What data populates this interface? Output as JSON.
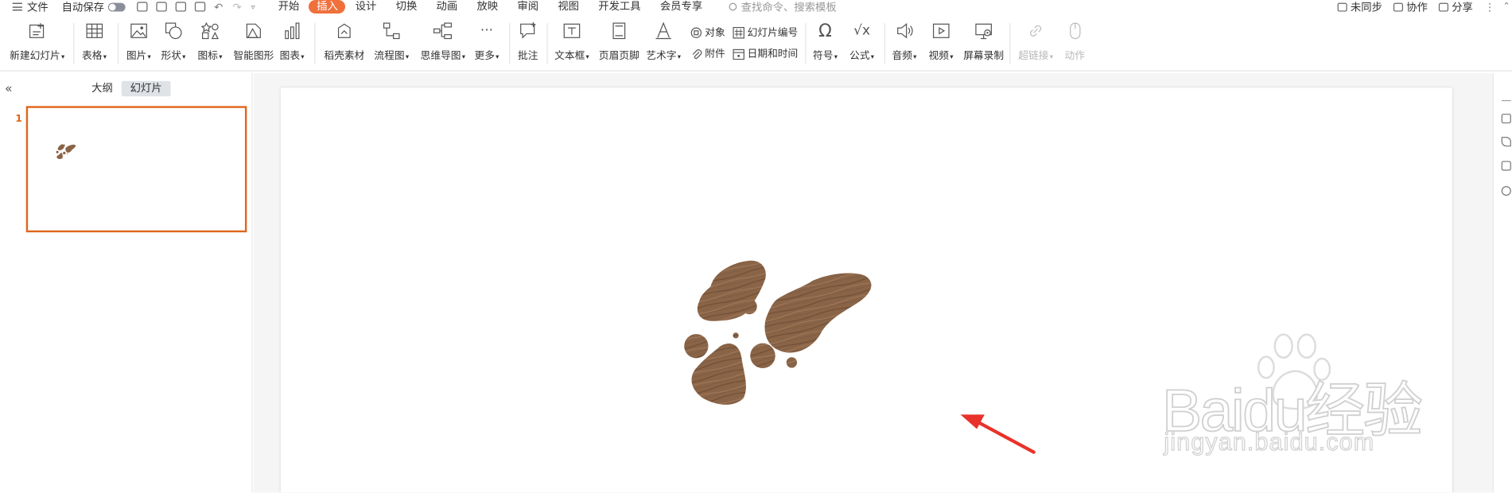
{
  "menubar": {
    "file": "文件",
    "autosave": "自动保存",
    "tabs": [
      "开始",
      "插入",
      "设计",
      "切换",
      "动画",
      "放映",
      "审阅",
      "视图",
      "开发工具",
      "会员专享"
    ],
    "active_tab": "插入",
    "search_placeholder": "查找命令、搜索模板",
    "sync": "未同步",
    "collab": "协作",
    "share": "分享"
  },
  "ribbon": {
    "new_slide": "新建幻灯片",
    "table": "表格",
    "picture": "图片",
    "shape": "形状",
    "icon": "图标",
    "smart_graphic": "智能图形",
    "chart": "图表",
    "material": "稻壳素材",
    "flowchart": "流程图",
    "mindmap": "思维导图",
    "more": "更多",
    "comment": "批注",
    "textbox": "文本框",
    "header_footer": "页眉页脚",
    "wordart": "艺术字",
    "object": "对象",
    "slide_number": "幻灯片编号",
    "attachment": "附件",
    "datetime": "日期和时间",
    "symbol": "符号",
    "formula": "公式",
    "audio": "音频",
    "video": "视频",
    "screen_record": "屏幕录制",
    "hyperlink": "超链接",
    "action": "动作"
  },
  "panel": {
    "outline_tab": "大纲",
    "slides_tab": "幻灯片",
    "slide_number": "1"
  },
  "watermark": {
    "brand": "Baidu经验",
    "url": "jingyan.baidu.com"
  },
  "colors": {
    "accent": "#f0703c",
    "wood": "#8a6447",
    "arrow": "#e8322a"
  }
}
